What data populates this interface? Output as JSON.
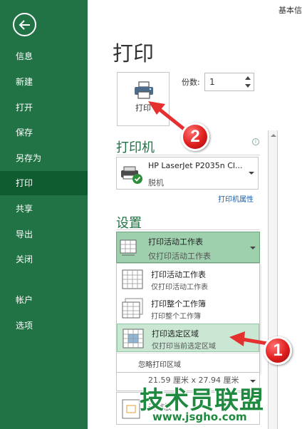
{
  "header": {
    "right_text": "基本信"
  },
  "sidebar": {
    "items": [
      {
        "label": "信息"
      },
      {
        "label": "新建"
      },
      {
        "label": "打开"
      },
      {
        "label": "保存"
      },
      {
        "label": "另存为"
      },
      {
        "label": "打印"
      },
      {
        "label": "共享"
      },
      {
        "label": "导出"
      },
      {
        "label": "关闭"
      },
      {
        "label": "帐户"
      },
      {
        "label": "选项"
      }
    ]
  },
  "main": {
    "title": "打印",
    "print_button_label": "打印",
    "copies_label": "份数:",
    "copies_value": "1",
    "printer_section": "打印机",
    "printer": {
      "name": "HP LaserJet P2035n Cl...",
      "status": "脱机"
    },
    "printer_properties": "打印机属性",
    "settings_section": "设置",
    "active_setting": {
      "title": "打印活动工作表",
      "subtitle": "仅打印活动工作表"
    },
    "menu": {
      "items": [
        {
          "title": "打印活动工作表",
          "subtitle": "仅打印活动工作表"
        },
        {
          "title": "打印整个工作簿",
          "subtitle": "打印整个工作簿"
        },
        {
          "title": "打印选定区域",
          "subtitle": "仅打印当前选定区域"
        }
      ],
      "ignore_area": "忽略打印区域"
    },
    "paper_size": "21.59 厘米 x 27.94 厘米",
    "scale_text": "无缩放"
  },
  "annotations": {
    "badge1": "1",
    "badge2": "2"
  },
  "watermark": {
    "main": "技术员联盟",
    "url": "www.jsgho.com"
  },
  "colors": {
    "sidebar": "#217346",
    "sidebar_active": "#0e5c30",
    "accent_green": "#217346",
    "selected_bg": "#9fd0ad",
    "arrow_red": "#e53030"
  }
}
